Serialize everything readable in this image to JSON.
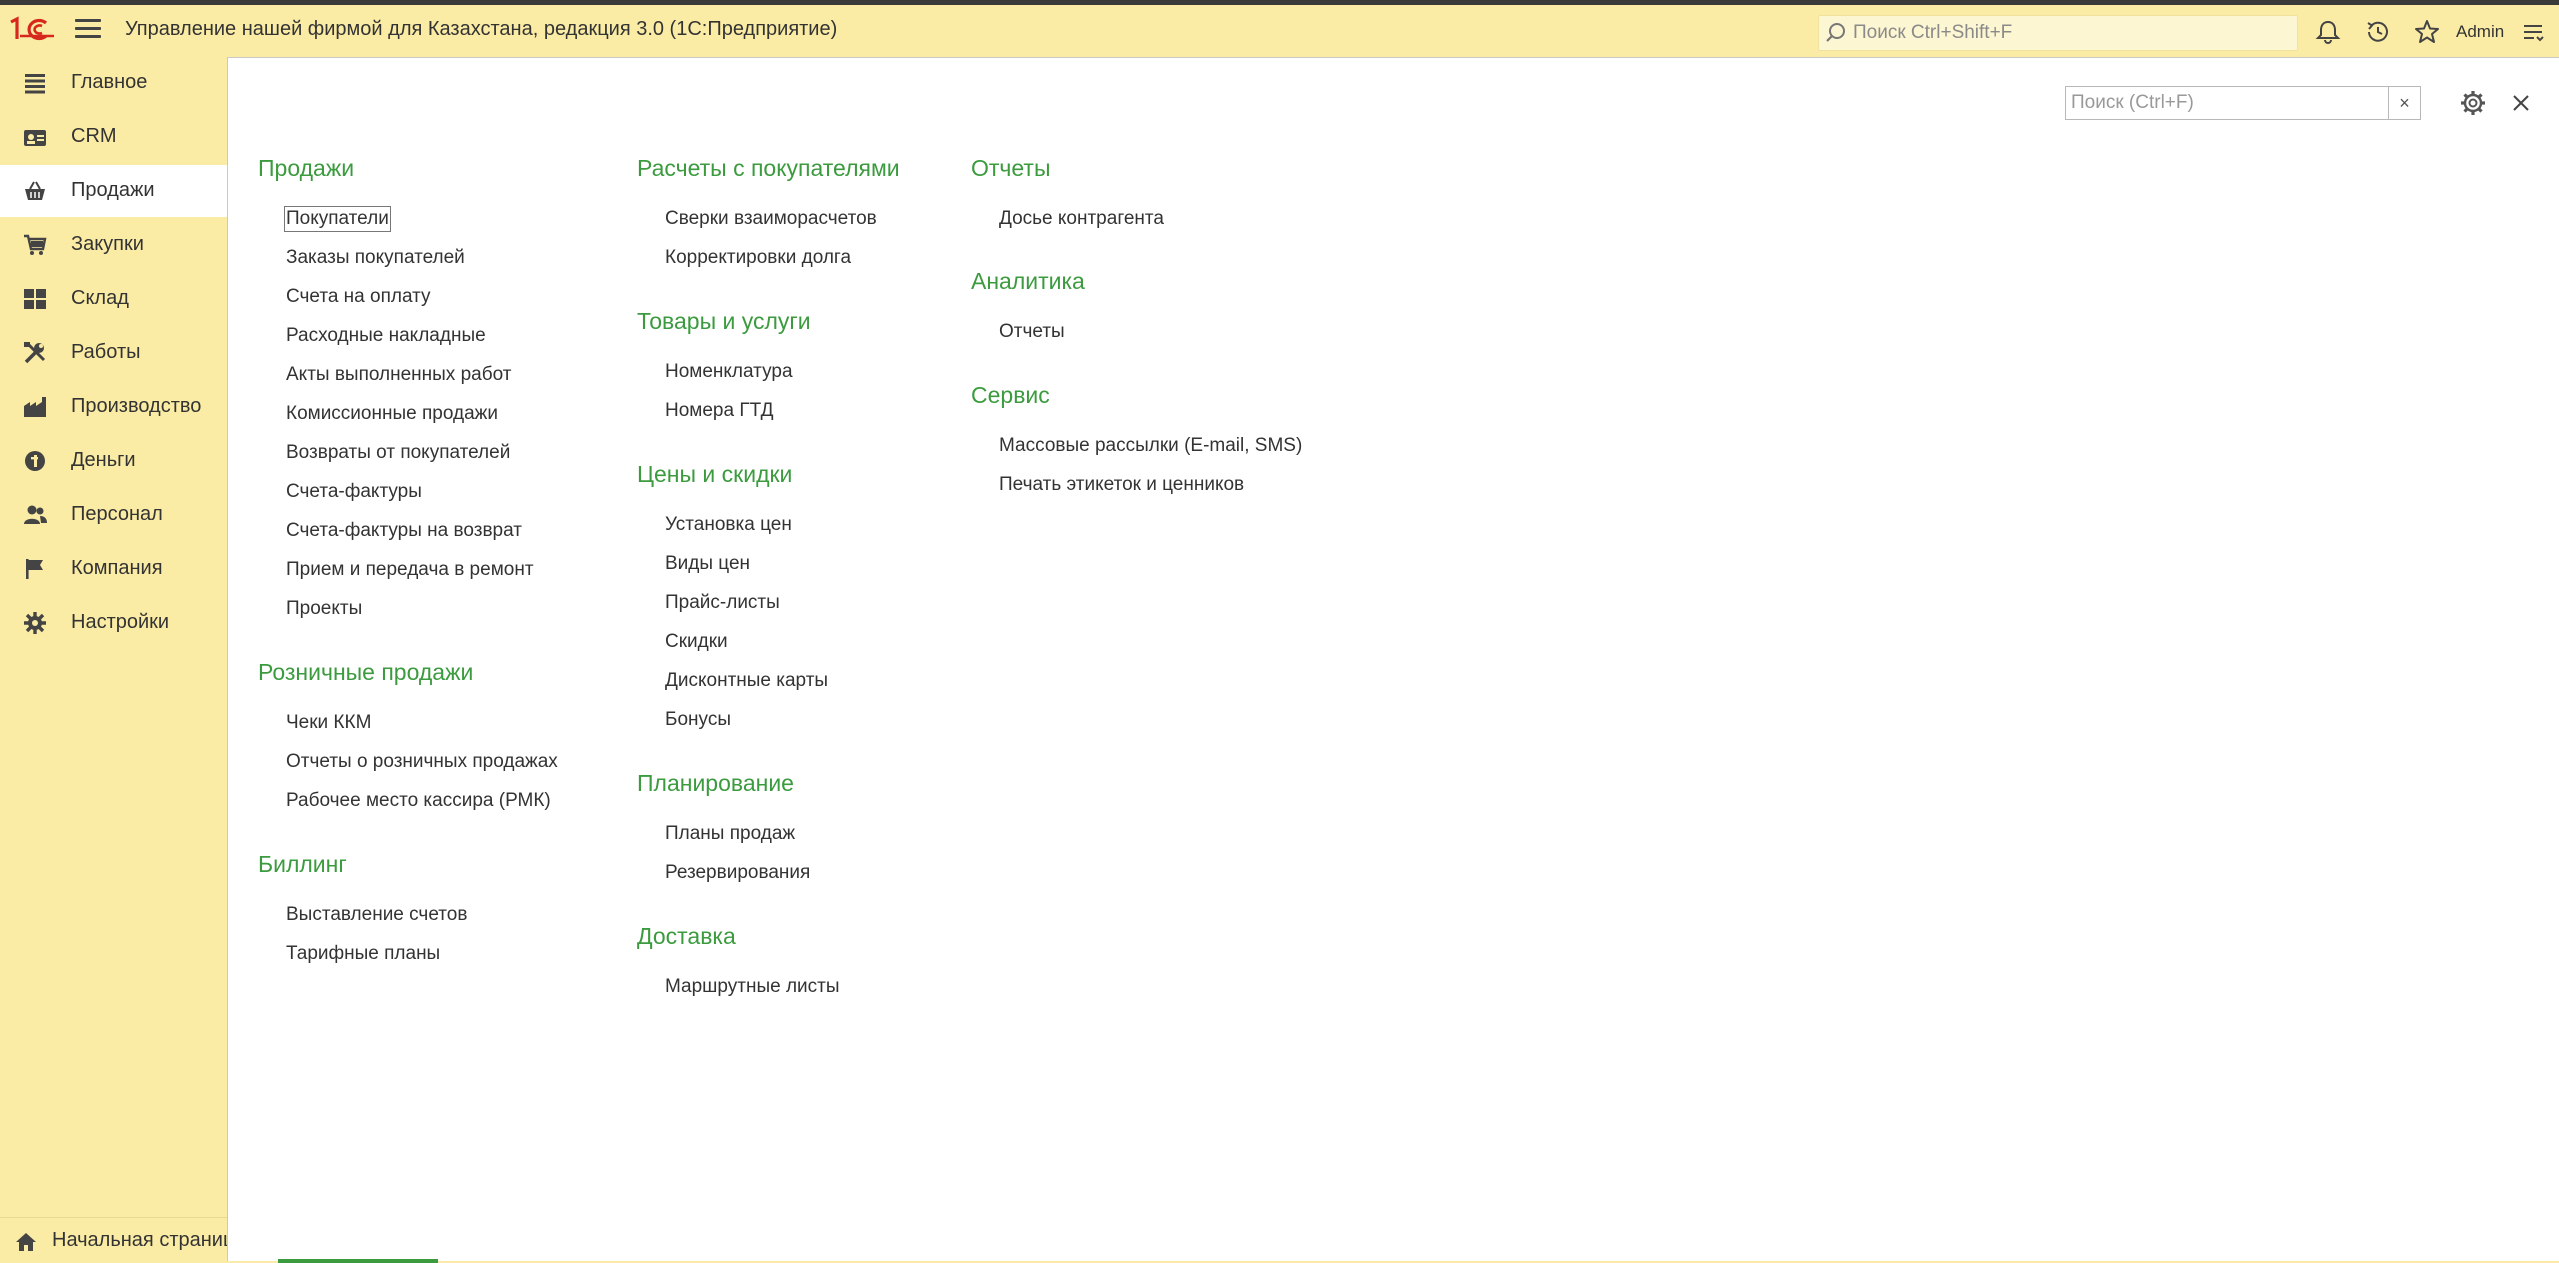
{
  "app": {
    "title": "Управление нашей фирмой для Казахстана, редакция 3.0  (1С:Предприятие)",
    "search_placeholder": "Поиск Ctrl+Shift+F",
    "user": "Admin"
  },
  "sidebar": {
    "items": [
      {
        "label": "Главное",
        "icon": "list-icon"
      },
      {
        "label": "CRM",
        "icon": "crm-icon"
      },
      {
        "label": "Продажи",
        "icon": "basket-icon",
        "active": true
      },
      {
        "label": "Закупки",
        "icon": "cart-icon"
      },
      {
        "label": "Склад",
        "icon": "warehouse-icon"
      },
      {
        "label": "Работы",
        "icon": "tools-icon"
      },
      {
        "label": "Производство",
        "icon": "factory-icon"
      },
      {
        "label": "Деньги",
        "icon": "money-icon"
      },
      {
        "label": "Персонал",
        "icon": "people-icon"
      },
      {
        "label": "Компания",
        "icon": "flag-icon"
      },
      {
        "label": "Настройки",
        "icon": "gear-icon"
      }
    ],
    "home_label": "Начальная страница"
  },
  "content": {
    "search_placeholder": "Поиск (Ctrl+F)",
    "clear_label": "×",
    "col1": {
      "sections": [
        {
          "title": "Продажи",
          "links": [
            "Покупатели",
            "Заказы покупателей",
            "Счета на оплату",
            "Расходные накладные",
            "Акты выполненных работ",
            "Комиссионные продажи",
            "Возвраты от покупателей",
            "Счета-фактуры",
            "Счета-фактуры на возврат",
            "Прием и передача в ремонт",
            "Проекты"
          ]
        },
        {
          "title": "Розничные продажи",
          "links": [
            "Чеки ККМ",
            "Отчеты о розничных продажах",
            "Рабочее место кассира (РМК)"
          ]
        },
        {
          "title": "Биллинг",
          "links": [
            "Выставление счетов",
            "Тарифные планы"
          ]
        }
      ]
    },
    "col2": {
      "sections": [
        {
          "title": "Расчеты с покупателями",
          "links": [
            "Сверки взаиморасчетов",
            "Корректировки долга"
          ]
        },
        {
          "title": "Товары и услуги",
          "links": [
            "Номенклатура",
            "Номера ГТД"
          ]
        },
        {
          "title": "Цены и скидки",
          "links": [
            "Установка цен",
            "Виды цен",
            "Прайс-листы",
            "Скидки",
            "Дисконтные карты",
            "Бонусы"
          ]
        },
        {
          "title": "Планирование",
          "links": [
            "Планы продаж",
            "Резервирования"
          ]
        },
        {
          "title": "Доставка",
          "links": [
            "Маршрутные листы"
          ]
        }
      ]
    },
    "col3": {
      "sections": [
        {
          "title": "Отчеты",
          "links": [
            "Досье контрагента"
          ]
        },
        {
          "title": "Аналитика",
          "links": [
            "Отчеты"
          ]
        },
        {
          "title": "Сервис",
          "links": [
            "Массовые рассылки (E-mail, SMS)",
            "Печать этикеток и ценников"
          ]
        }
      ]
    }
  },
  "colors": {
    "sidebar_bg": "#fbeca5",
    "section_title": "#3b9b3e",
    "active_bg": "#ffffff"
  }
}
